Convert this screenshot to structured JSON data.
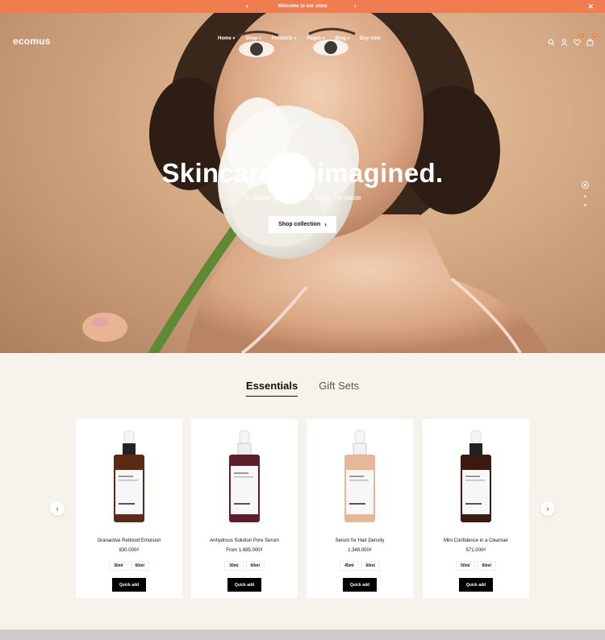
{
  "announcement": {
    "text": "Welcome to our store",
    "prev_icon": "chevron-left-icon",
    "next_icon": "chevron-right-icon",
    "close_icon": "close-icon"
  },
  "header": {
    "logo": "ecomus",
    "nav": [
      {
        "label": "Home",
        "has_dropdown": true
      },
      {
        "label": "Shop",
        "has_dropdown": true
      },
      {
        "label": "Products",
        "has_dropdown": true
      },
      {
        "label": "Pages",
        "has_dropdown": true
      },
      {
        "label": "Blog",
        "has_dropdown": true
      },
      {
        "label": "Buy now",
        "has_dropdown": false
      }
    ],
    "icons": [
      "search-icon",
      "user-icon",
      "heart-icon",
      "cart-icon"
    ],
    "wishlist_count": "0",
    "cart_count": "0"
  },
  "hero": {
    "title": "Skincare Reimagined.",
    "subtitle": "To deliver peak potency, minus the waste",
    "button_label": "Shop collection",
    "slide_count": 3,
    "active_slide": 1
  },
  "tabs": [
    {
      "label": "Essentials",
      "active": true
    },
    {
      "label": "Gift Sets",
      "active": false
    }
  ],
  "products": [
    {
      "name": "Granactive Retinoid Emulsion",
      "price": "830.000₫",
      "variants": [
        "30ml",
        "60ml"
      ],
      "button": "Quick add",
      "liquid_color": "#5a2a17"
    },
    {
      "name": "Anhydrous Solution Pore Serum",
      "price": "From 1.685.000₫",
      "variants": [
        "30ml",
        "60ml"
      ],
      "button": "Quick add",
      "liquid_color": "#5b1e2c"
    },
    {
      "name": "Serum for Hair Density",
      "price": "1.348.000₫",
      "variants": [
        "45ml",
        "60ml"
      ],
      "button": "Quick add",
      "liquid_color": "#e8b79a"
    },
    {
      "name": "Mini Confidence in a Cleanser",
      "price": "571.000₫",
      "variants": [
        "50ml",
        "60ml"
      ],
      "button": "Quick add",
      "liquid_color": "#3b1a10"
    }
  ],
  "colors": {
    "accent": "#f07c4f",
    "background": "#f6f2ec"
  }
}
